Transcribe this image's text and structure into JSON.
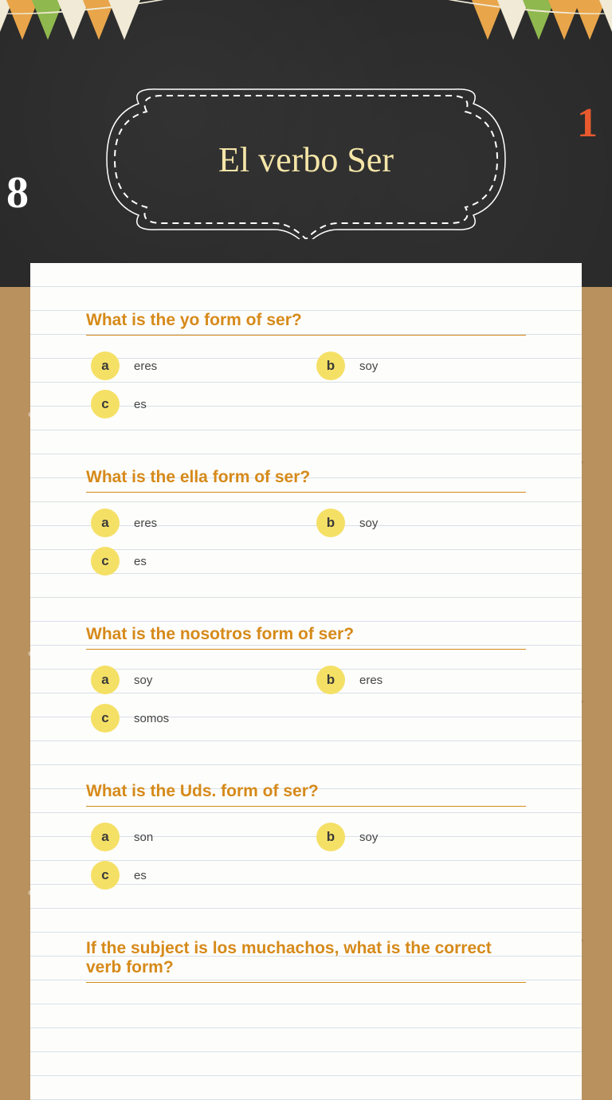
{
  "title": "El verbo Ser",
  "decor": {
    "left_number": "8",
    "right_number": "1"
  },
  "questions": [
    {
      "prompt": "What is the yo form of ser?",
      "options": [
        {
          "letter": "a",
          "text": "eres"
        },
        {
          "letter": "b",
          "text": "soy"
        },
        {
          "letter": "c",
          "text": "es"
        }
      ]
    },
    {
      "prompt": "What is the ella form of ser?",
      "options": [
        {
          "letter": "a",
          "text": "eres"
        },
        {
          "letter": "b",
          "text": "soy"
        },
        {
          "letter": "c",
          "text": "es"
        }
      ]
    },
    {
      "prompt": "What is the nosotros form of ser?",
      "options": [
        {
          "letter": "a",
          "text": "soy"
        },
        {
          "letter": "b",
          "text": "eres"
        },
        {
          "letter": "c",
          "text": "somos"
        }
      ]
    },
    {
      "prompt": "What is the Uds. form of ser?",
      "options": [
        {
          "letter": "a",
          "text": "son"
        },
        {
          "letter": "b",
          "text": "soy"
        },
        {
          "letter": "c",
          "text": "es"
        }
      ]
    },
    {
      "prompt": "If the subject is los muchachos, what is the correct verb form?",
      "options": []
    }
  ]
}
